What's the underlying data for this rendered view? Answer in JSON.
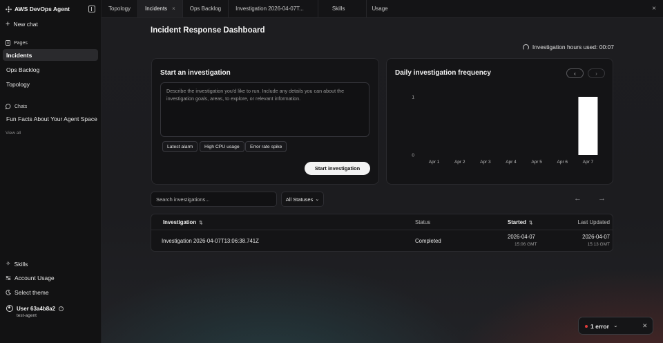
{
  "sidebar": {
    "app_name": "AWS DevOps Agent",
    "new_chat": "New chat",
    "pages_heading": "Pages",
    "pages": [
      {
        "label": "Incidents",
        "active": true
      },
      {
        "label": "Ops Backlog",
        "active": false
      },
      {
        "label": "Topology",
        "active": false
      }
    ],
    "chats_heading": "Chats",
    "chats": [
      {
        "label": "Fun Facts About Your Agent Space"
      }
    ],
    "view_all": "View all",
    "bottom": [
      {
        "label": "Skills",
        "icon": "sparkle-icon"
      },
      {
        "label": "Account Usage",
        "icon": "sliders-icon"
      },
      {
        "label": "Select theme",
        "icon": "moon-icon"
      }
    ],
    "user": {
      "name": "User 63a4b8a2",
      "sub": "test-agent"
    }
  },
  "tabs": [
    {
      "label": "Topology",
      "active": false,
      "closable": false
    },
    {
      "label": "Incidents",
      "active": true,
      "closable": true
    },
    {
      "label": "Ops Backlog",
      "active": false,
      "closable": false
    },
    {
      "label": "Investigation 2026-04-07T...",
      "active": false,
      "closable": false
    },
    {
      "label": "Skills",
      "active": false,
      "closable": false
    },
    {
      "label": "Usage",
      "active": false,
      "closable": false
    }
  ],
  "page_title": "Incident Response Dashboard",
  "hours_used": "Investigation hours used: 00:07",
  "start_card": {
    "title": "Start an investigation",
    "placeholder": "Describe the investigation you'd like to run. Include any details you can about the investigation goals, areas, to explore, or relevant information.",
    "chips": [
      "Latest alarm",
      "High CPU usage",
      "Error rate spike"
    ],
    "button": "Start investigation"
  },
  "freq_card": {
    "title": "Daily investigation frequency"
  },
  "chart_data": {
    "type": "bar",
    "title": "Daily investigation frequency",
    "categories": [
      "Apr 1",
      "Apr 2",
      "Apr 3",
      "Apr 4",
      "Apr 5",
      "Apr 6",
      "Apr 7"
    ],
    "values": [
      0,
      0,
      0,
      0,
      0,
      0,
      1
    ],
    "yticks": [
      "0",
      "1"
    ],
    "ylim": [
      0,
      1
    ],
    "grid": false,
    "bar_color": "#ffffff"
  },
  "list": {
    "search_placeholder": "Search investigations...",
    "status_filter": "All Statuses",
    "columns": [
      "Investigation",
      "Status",
      "Started",
      "Last Updated"
    ],
    "rows": [
      {
        "name": "Investigation 2026-04-07T13:06:38.741Z",
        "status": "Completed",
        "started_date": "2026-04-07",
        "started_time": "15:06 GMT",
        "updated_date": "2026-04-07",
        "updated_time": "15:13 GMT"
      }
    ]
  },
  "toast": {
    "text": "1 error"
  },
  "colors": {
    "accent": "#f2f2f2",
    "error": "#e03b3b",
    "background": "#1c1c1f"
  }
}
